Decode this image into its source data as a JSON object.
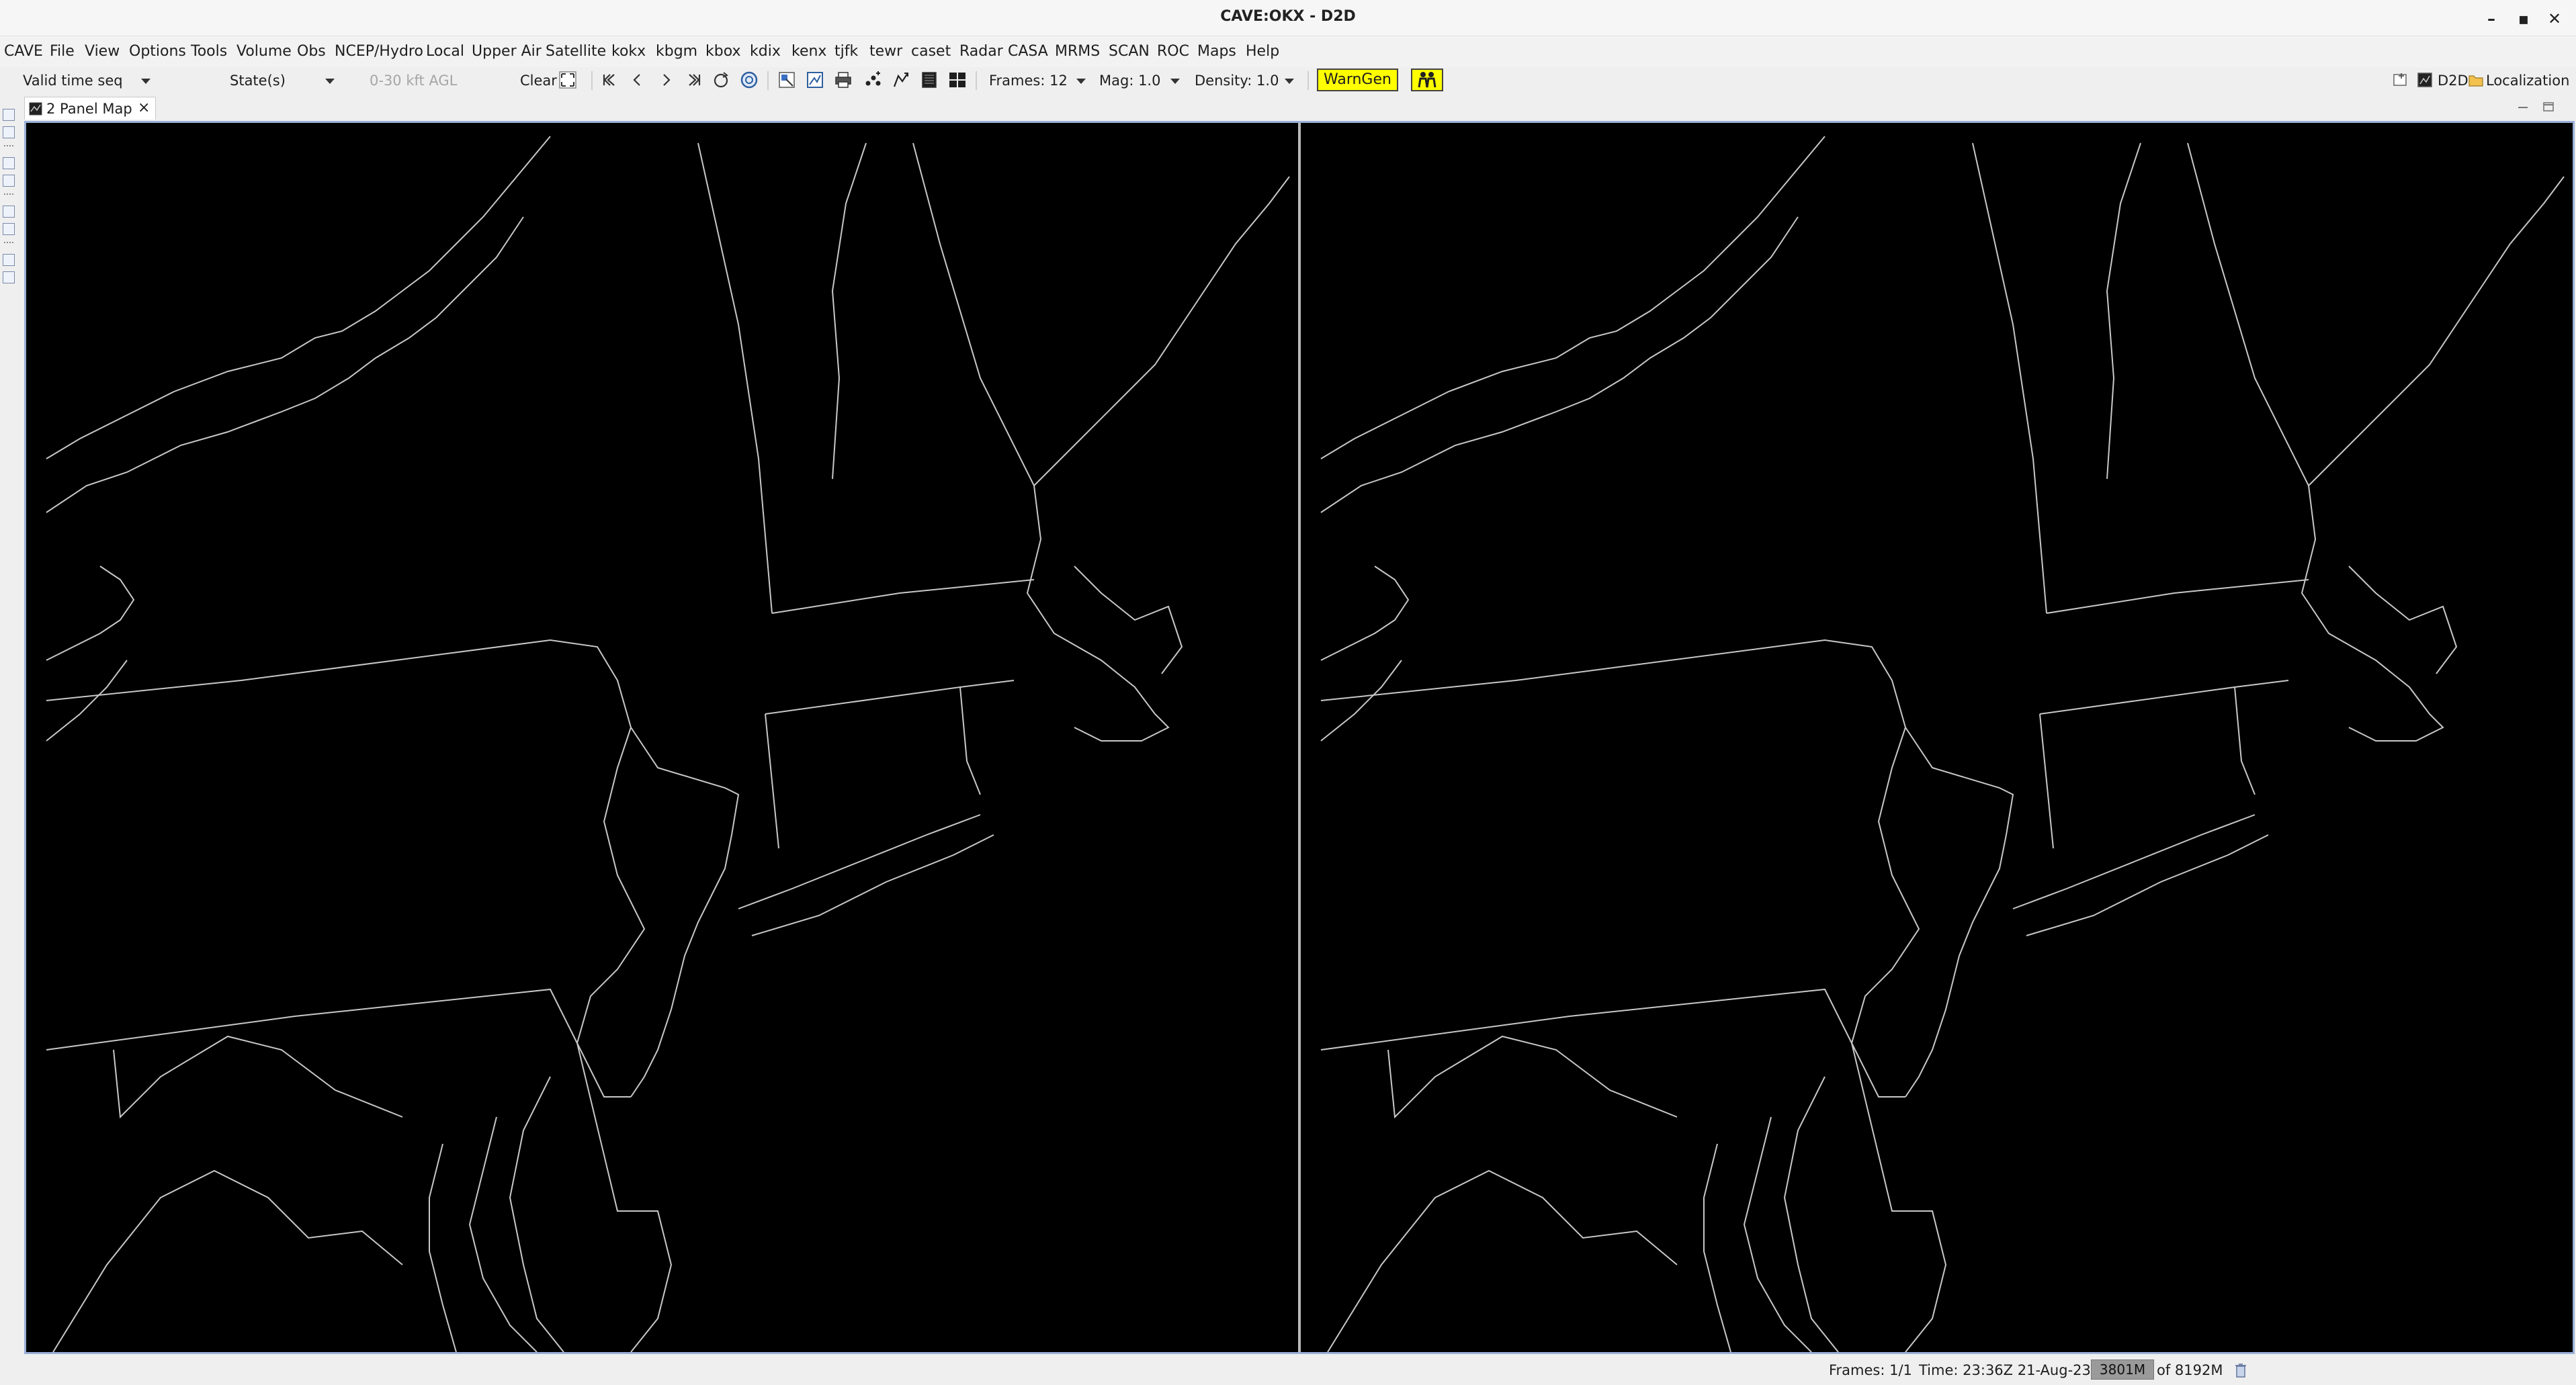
{
  "window": {
    "title": "CAVE:OKX - D2D",
    "minimize": "–",
    "maximize": "▪",
    "close": "✕"
  },
  "menu": [
    "CAVE",
    "File",
    "View",
    "Options",
    "Tools",
    "Volume",
    "Obs",
    "NCEP/Hydro",
    "Local",
    "Upper Air",
    "Satellite",
    "kokx",
    "kbgm",
    "kbox",
    "kdix",
    "kenx",
    "tjfk",
    "tewr",
    "caset",
    "Radar",
    "CASA",
    "MRMS",
    "SCAN",
    "ROC",
    "Maps",
    "Help"
  ],
  "toolbar": {
    "loop_mode": "Valid time seq",
    "states": "State(s)",
    "layer": "0-30 kft AGL",
    "clear": "Clear",
    "frames": "Frames: 12",
    "mag": "Mag: 1.0",
    "density": "Density: 1.0",
    "warngen": "WarnGen",
    "perspective_d2d": "D2D",
    "perspective_localization": "Localization"
  },
  "tab": {
    "label": "2 Panel Map",
    "close": "×"
  },
  "status": {
    "frames": "Frames: 1/1",
    "time": "Time: 23:36Z 21-Aug-23",
    "memory_used": "3801M",
    "memory_total": "of 8192M"
  },
  "icons": {
    "first_frame": "first-frame-icon",
    "prev_frame": "previous-frame-icon",
    "next_frame": "next-frame-icon",
    "last_frame": "last-frame-icon",
    "loop": "loop-icon",
    "refresh": "refresh-icon",
    "print": "print-icon",
    "warngen_figure": "people-icon"
  },
  "colors": {
    "map_background": "#000000",
    "map_outlines": "#c8c8c8",
    "warngen": "#ffff00",
    "frame_border": "#9bb0d9"
  }
}
